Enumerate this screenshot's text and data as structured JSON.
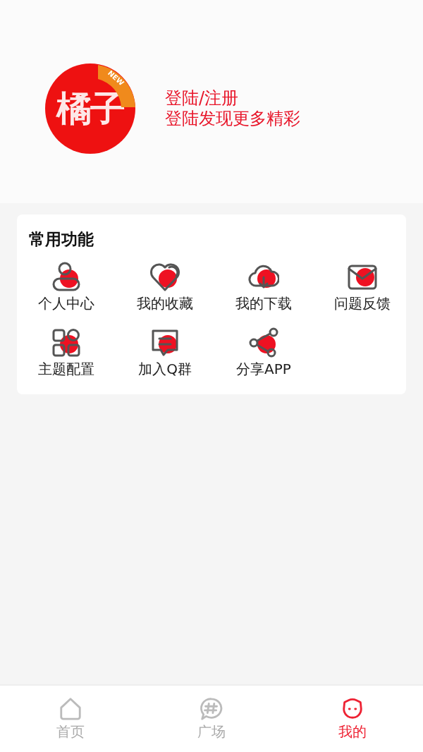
{
  "profile": {
    "logo_text": "橘子",
    "logo_badge": "NEW",
    "login": "登陆/注册",
    "subtitle": "登陆发现更多精彩"
  },
  "functions": {
    "title": "常用功能",
    "items": [
      {
        "label": "个人中心"
      },
      {
        "label": "我的收藏"
      },
      {
        "label": "我的下载"
      },
      {
        "label": "问题反馈"
      },
      {
        "label": "主题配置"
      },
      {
        "label": "加入Q群"
      },
      {
        "label": "分享APP"
      }
    ]
  },
  "tab_bar": [
    {
      "label": "首页",
      "selected": false
    },
    {
      "label": "广场",
      "selected": false
    },
    {
      "label": "我的",
      "selected": true
    }
  ]
}
